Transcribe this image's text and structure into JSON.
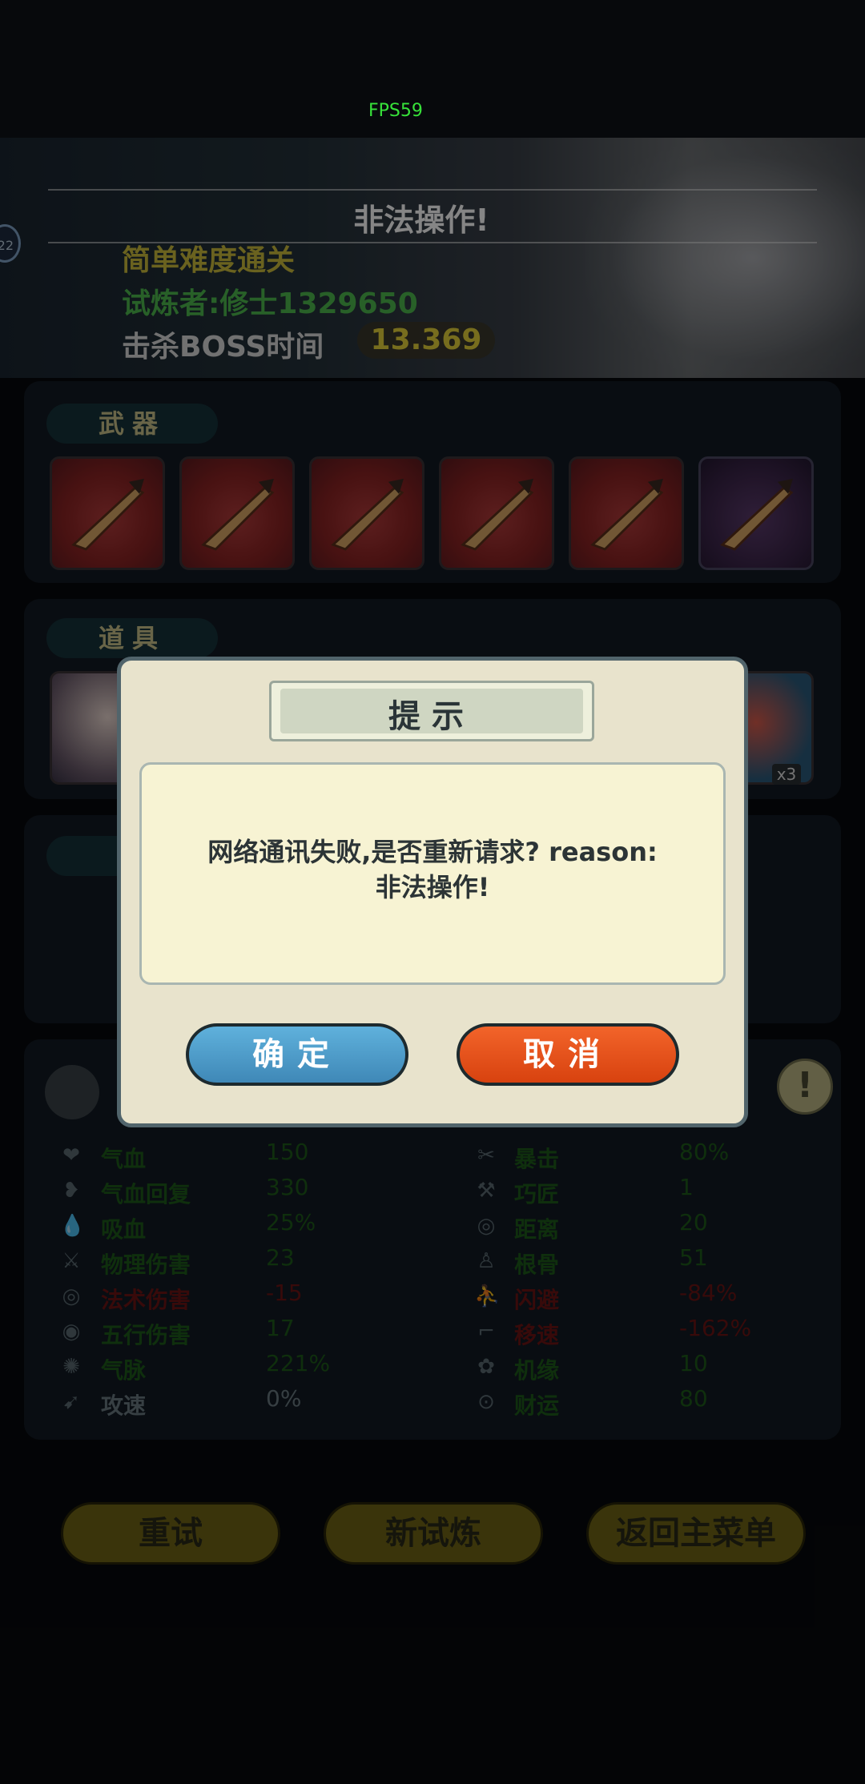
{
  "status": {
    "fps": "FPS59"
  },
  "banner": {
    "notice": "非法操作!",
    "badge": "22",
    "difficulty": "简单难度通关",
    "challenger": "试炼者:修士1329650",
    "boss_time_label": "击杀BOSS时间",
    "boss_time_value": "13.369"
  },
  "weapons": {
    "label": "武器",
    "slots": [
      "sword-icon",
      "sword-icon",
      "sword-icon",
      "sword-icon",
      "sword-icon",
      "sword-icon"
    ]
  },
  "items": {
    "label": "道具",
    "count": "x3"
  },
  "stats": {
    "left": [
      {
        "icon": "heart-icon",
        "label": "气血",
        "value": "150",
        "tone": "green"
      },
      {
        "icon": "heart-regen-icon",
        "label": "气血回复",
        "value": "330",
        "tone": "green"
      },
      {
        "icon": "drop-icon",
        "label": "吸血",
        "value": "25%",
        "tone": "green"
      },
      {
        "icon": "blade-icon",
        "label": "物理伤害",
        "value": "23",
        "tone": "green"
      },
      {
        "icon": "swirl-icon",
        "label": "法术伤害",
        "value": "-15",
        "tone": "red"
      },
      {
        "icon": "five-elements-icon",
        "label": "五行伤害",
        "value": "17",
        "tone": "green"
      },
      {
        "icon": "aura-icon",
        "label": "气脉",
        "value": "221%",
        "tone": "green"
      },
      {
        "icon": "attack-speed-icon",
        "label": "攻速",
        "value": "0%",
        "tone": "gray"
      }
    ],
    "right": [
      {
        "icon": "crit-icon",
        "label": "暴击",
        "value": "80%",
        "tone": "green"
      },
      {
        "icon": "hammer-icon",
        "label": "巧匠",
        "value": "1",
        "tone": "green"
      },
      {
        "icon": "target-icon",
        "label": "距离",
        "value": "20",
        "tone": "green"
      },
      {
        "icon": "meditate-icon",
        "label": "根骨",
        "value": "51",
        "tone": "green"
      },
      {
        "icon": "dodge-icon",
        "label": "闪避",
        "value": "-84%",
        "tone": "red"
      },
      {
        "icon": "boot-icon",
        "label": "移速",
        "value": "-162%",
        "tone": "red"
      },
      {
        "icon": "luck-icon",
        "label": "机缘",
        "value": "10",
        "tone": "green"
      },
      {
        "icon": "coin-icon",
        "label": "财运",
        "value": "80",
        "tone": "green"
      }
    ]
  },
  "bottom_buttons": {
    "retry": "重试",
    "new_trial": "新试炼",
    "main_menu": "返回主菜单"
  },
  "dialog": {
    "title": "提示",
    "message_line1": "网络通讯失败,是否重新请求? reason:",
    "message_line2": "非法操作!",
    "confirm": "确定",
    "cancel": "取消"
  },
  "help": {
    "symbol": "!"
  }
}
